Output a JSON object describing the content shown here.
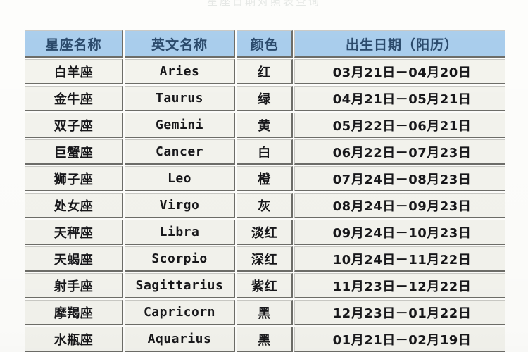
{
  "page": {
    "top_remnant_text": "星座日期对照表查询"
  },
  "table": {
    "name": "zodiac-date-table",
    "columns": [
      {
        "key": "name",
        "label": "星座名称"
      },
      {
        "key": "en",
        "label": "英文名称"
      },
      {
        "key": "color",
        "label": "颜色"
      },
      {
        "key": "date",
        "label": "出生日期（阳历）"
      }
    ],
    "rows": [
      {
        "name": "白羊座",
        "en": "Aries",
        "color": "红",
        "date": "03月21日－04月20日"
      },
      {
        "name": "金牛座",
        "en": "Taurus",
        "color": "绿",
        "date": "04月21日－05月21日"
      },
      {
        "name": "双子座",
        "en": "Gemini",
        "color": "黄",
        "date": "05月22日－06月21日"
      },
      {
        "name": "巨蟹座",
        "en": "Cancer",
        "color": "白",
        "date": "06月22日－07月23日"
      },
      {
        "name": "狮子座",
        "en": "Leo",
        "color": "橙",
        "date": "07月24日－08月23日"
      },
      {
        "name": "处女座",
        "en": "Virgo",
        "color": "灰",
        "date": "08月24日－09月23日"
      },
      {
        "name": "天秤座",
        "en": "Libra",
        "color": "淡红",
        "date": "09月24日－10月23日"
      },
      {
        "name": "天蝎座",
        "en": "Scorpio",
        "color": "深红",
        "date": "10月24日－11月22日"
      },
      {
        "name": "射手座",
        "en": "Sagittarius",
        "color": "紫红",
        "date": "11月23日－12月22日"
      },
      {
        "name": "摩羯座",
        "en": "Capricorn",
        "color": "黑",
        "date": "12月23日－01月22日"
      },
      {
        "name": "水瓶座",
        "en": "Aquarius",
        "color": "黑",
        "date": "01月21日－02月19日"
      }
    ]
  },
  "colors": {
    "header_background": "#a9cdec",
    "header_text": "#2b4a6b",
    "cell_background": "#f3f3ed",
    "cell_text": "#17171a",
    "border_dark": "#6d6d68",
    "border_light": "#c9c9c4",
    "page_background": "#fdfdfb"
  }
}
